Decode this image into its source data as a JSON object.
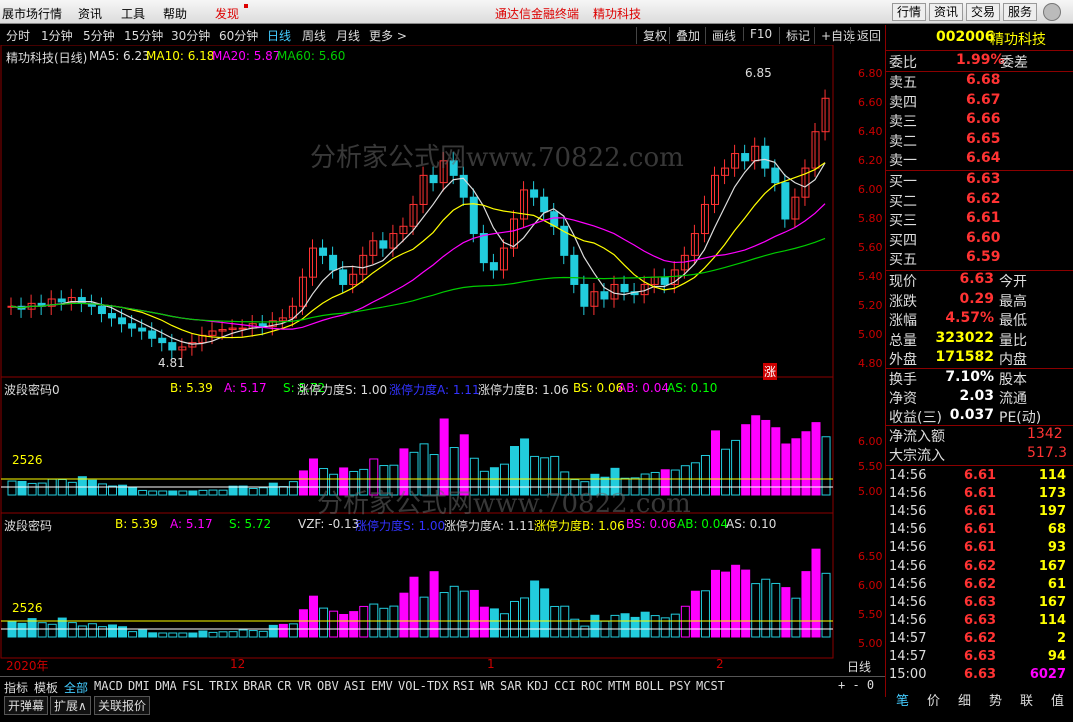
{
  "menu": {
    "items": [
      "展市场行情",
      "资讯",
      "工具",
      "帮助",
      "发现"
    ],
    "center_brand": "通达信金融终端",
    "center_stock": "精功科技",
    "right_buttons": [
      "行情",
      "资讯",
      "交易",
      "服务"
    ]
  },
  "toolbar": {
    "periods": [
      "分时",
      "1分钟",
      "5分钟",
      "15分钟",
      "30分钟",
      "60分钟",
      "日线",
      "周线",
      "月线",
      "更多 >"
    ],
    "active": "日线",
    "tools": [
      "复权",
      "叠加",
      "画线",
      "F10",
      "标记",
      "+自选",
      "返回"
    ]
  },
  "main": {
    "title": "精功科技(日线)",
    "ma5": "MA5: 6.23",
    "ma10": "MA10: 6.18",
    "ma20": "MA20: 5.87",
    "ma60": "MA60: 5.60",
    "high_label": "6.85",
    "low_label": "4.81",
    "yticks": [
      "6.80",
      "6.60",
      "6.40",
      "6.20",
      "6.00",
      "5.80",
      "5.60",
      "5.40",
      "5.20",
      "5.00",
      "4.80"
    ],
    "watermark": "分析家公式网www.70822.com",
    "zhang_badge": "涨"
  },
  "ind1": {
    "title": "波段密码0",
    "b": "B: 5.39",
    "a": "A: 5.17",
    "s": "S: 5.72",
    "zts": "涨停力度S: 1.00",
    "zta": "涨停力度A: 1.11",
    "ztb": "涨停力度B: 1.06",
    "bs": "BS: 0.06",
    "ab": "AB: 0.04",
    "as": "AS: 0.10",
    "yticks": [
      "6.00",
      "5.50",
      "5.00"
    ],
    "label2526": "2526"
  },
  "ind2": {
    "title": "波段密码",
    "b": "B: 5.39",
    "a": "A: 5.17",
    "s": "S: 5.72",
    "vzf": "VZF: -0.13",
    "zts": "涨停力度S: 1.00",
    "zta": "涨停力度A: 1.11",
    "ztb": "涨停力度B: 1.06",
    "bs": "BS: 0.06",
    "ab": "AB: 0.04",
    "as": "AS: 0.10",
    "yticks": [
      "6.50",
      "6.00",
      "5.50",
      "5.00"
    ],
    "label2526": "2526"
  },
  "xaxis": {
    "labels": [
      "2020年",
      "12",
      "1",
      "2"
    ],
    "period": "日线"
  },
  "quote": {
    "code": "002006",
    "name": "精功科技",
    "webi_label": "委比",
    "webi_val": "1.99%",
    "weicha_label": "委差",
    "asks": [
      {
        "l": "卖五",
        "p": "6.68"
      },
      {
        "l": "卖四",
        "p": "6.67"
      },
      {
        "l": "卖三",
        "p": "6.66"
      },
      {
        "l": "卖二",
        "p": "6.65"
      },
      {
        "l": "卖一",
        "p": "6.64"
      }
    ],
    "bids": [
      {
        "l": "买一",
        "p": "6.63"
      },
      {
        "l": "买二",
        "p": "6.62"
      },
      {
        "l": "买三",
        "p": "6.61"
      },
      {
        "l": "买四",
        "p": "6.60"
      },
      {
        "l": "买五",
        "p": "6.59"
      }
    ],
    "stats": [
      {
        "l": "现价",
        "v": "6.63",
        "r": "今开"
      },
      {
        "l": "涨跌",
        "v": "0.29",
        "r": "最高"
      },
      {
        "l": "涨幅",
        "v": "4.57%",
        "r": "最低"
      },
      {
        "l": "总量",
        "v": "323022",
        "r": "量比"
      },
      {
        "l": "外盘",
        "v": "171582",
        "r": "内盘"
      }
    ],
    "stats2": [
      {
        "l": "换手",
        "v": "7.10%",
        "r": "股本"
      },
      {
        "l": "净资",
        "v": "2.03",
        "r": "流通"
      },
      {
        "l": "收益(三)",
        "v": "0.037",
        "r": "PE(动)"
      }
    ],
    "netflow_label": "净流入额",
    "netflow_val": "1342",
    "bigflow_label": "大宗流入",
    "bigflow_val": "517.3",
    "ticks": [
      [
        "14:56",
        "6.61",
        "114"
      ],
      [
        "14:56",
        "6.61",
        "173"
      ],
      [
        "14:56",
        "6.61",
        "197"
      ],
      [
        "14:56",
        "6.61",
        "68"
      ],
      [
        "14:56",
        "6.61",
        "93"
      ],
      [
        "14:56",
        "6.62",
        "167"
      ],
      [
        "14:56",
        "6.62",
        "61"
      ],
      [
        "14:56",
        "6.63",
        "167"
      ],
      [
        "14:56",
        "6.63",
        "114"
      ],
      [
        "14:57",
        "6.62",
        "2"
      ],
      [
        "14:57",
        "6.63",
        "94"
      ],
      [
        "15:00",
        "6.63",
        "6027"
      ]
    ],
    "bottom_tabs": [
      "笔",
      "价",
      "细",
      "势",
      "联",
      "值"
    ]
  },
  "bottom": {
    "tabs": [
      "指标",
      "模板",
      "全部",
      "MACD",
      "DMI",
      "DMA",
      "FSL",
      "TRIX",
      "BRAR",
      "CR",
      "VR",
      "OBV",
      "ASI",
      "EMV",
      "VOL-TDX",
      "RSI",
      "WR",
      "SAR",
      "KDJ",
      "CCI",
      "ROC",
      "MTM",
      "BOLL",
      "PSY",
      "MCST"
    ],
    "row2": [
      "开弹幕",
      "扩展∧",
      "关联报价"
    ],
    "plusminus": "+ - 0"
  }
}
